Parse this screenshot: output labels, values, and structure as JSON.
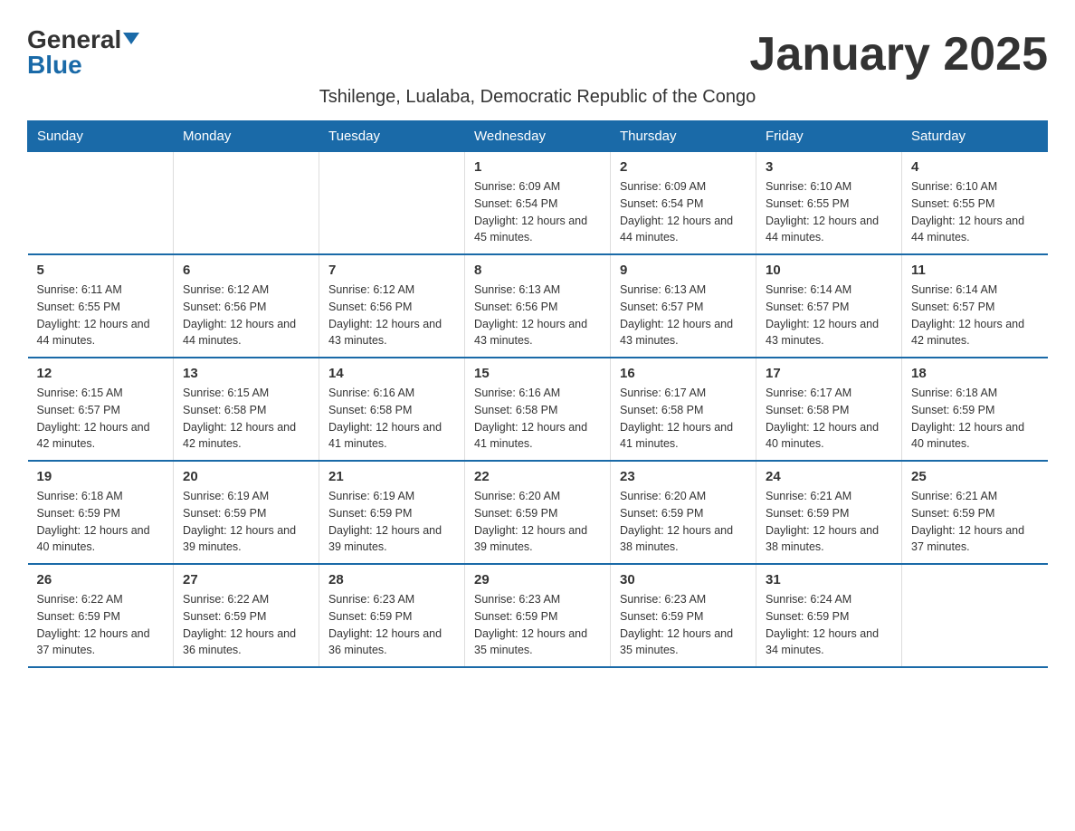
{
  "logo": {
    "general": "General",
    "blue": "Blue"
  },
  "title": "January 2025",
  "subtitle": "Tshilenge, Lualaba, Democratic Republic of the Congo",
  "days_of_week": [
    "Sunday",
    "Monday",
    "Tuesday",
    "Wednesday",
    "Thursday",
    "Friday",
    "Saturday"
  ],
  "weeks": [
    [
      {
        "day": "",
        "info": ""
      },
      {
        "day": "",
        "info": ""
      },
      {
        "day": "",
        "info": ""
      },
      {
        "day": "1",
        "info": "Sunrise: 6:09 AM\nSunset: 6:54 PM\nDaylight: 12 hours and 45 minutes."
      },
      {
        "day": "2",
        "info": "Sunrise: 6:09 AM\nSunset: 6:54 PM\nDaylight: 12 hours and 44 minutes."
      },
      {
        "day": "3",
        "info": "Sunrise: 6:10 AM\nSunset: 6:55 PM\nDaylight: 12 hours and 44 minutes."
      },
      {
        "day": "4",
        "info": "Sunrise: 6:10 AM\nSunset: 6:55 PM\nDaylight: 12 hours and 44 minutes."
      }
    ],
    [
      {
        "day": "5",
        "info": "Sunrise: 6:11 AM\nSunset: 6:55 PM\nDaylight: 12 hours and 44 minutes."
      },
      {
        "day": "6",
        "info": "Sunrise: 6:12 AM\nSunset: 6:56 PM\nDaylight: 12 hours and 44 minutes."
      },
      {
        "day": "7",
        "info": "Sunrise: 6:12 AM\nSunset: 6:56 PM\nDaylight: 12 hours and 43 minutes."
      },
      {
        "day": "8",
        "info": "Sunrise: 6:13 AM\nSunset: 6:56 PM\nDaylight: 12 hours and 43 minutes."
      },
      {
        "day": "9",
        "info": "Sunrise: 6:13 AM\nSunset: 6:57 PM\nDaylight: 12 hours and 43 minutes."
      },
      {
        "day": "10",
        "info": "Sunrise: 6:14 AM\nSunset: 6:57 PM\nDaylight: 12 hours and 43 minutes."
      },
      {
        "day": "11",
        "info": "Sunrise: 6:14 AM\nSunset: 6:57 PM\nDaylight: 12 hours and 42 minutes."
      }
    ],
    [
      {
        "day": "12",
        "info": "Sunrise: 6:15 AM\nSunset: 6:57 PM\nDaylight: 12 hours and 42 minutes."
      },
      {
        "day": "13",
        "info": "Sunrise: 6:15 AM\nSunset: 6:58 PM\nDaylight: 12 hours and 42 minutes."
      },
      {
        "day": "14",
        "info": "Sunrise: 6:16 AM\nSunset: 6:58 PM\nDaylight: 12 hours and 41 minutes."
      },
      {
        "day": "15",
        "info": "Sunrise: 6:16 AM\nSunset: 6:58 PM\nDaylight: 12 hours and 41 minutes."
      },
      {
        "day": "16",
        "info": "Sunrise: 6:17 AM\nSunset: 6:58 PM\nDaylight: 12 hours and 41 minutes."
      },
      {
        "day": "17",
        "info": "Sunrise: 6:17 AM\nSunset: 6:58 PM\nDaylight: 12 hours and 40 minutes."
      },
      {
        "day": "18",
        "info": "Sunrise: 6:18 AM\nSunset: 6:59 PM\nDaylight: 12 hours and 40 minutes."
      }
    ],
    [
      {
        "day": "19",
        "info": "Sunrise: 6:18 AM\nSunset: 6:59 PM\nDaylight: 12 hours and 40 minutes."
      },
      {
        "day": "20",
        "info": "Sunrise: 6:19 AM\nSunset: 6:59 PM\nDaylight: 12 hours and 39 minutes."
      },
      {
        "day": "21",
        "info": "Sunrise: 6:19 AM\nSunset: 6:59 PM\nDaylight: 12 hours and 39 minutes."
      },
      {
        "day": "22",
        "info": "Sunrise: 6:20 AM\nSunset: 6:59 PM\nDaylight: 12 hours and 39 minutes."
      },
      {
        "day": "23",
        "info": "Sunrise: 6:20 AM\nSunset: 6:59 PM\nDaylight: 12 hours and 38 minutes."
      },
      {
        "day": "24",
        "info": "Sunrise: 6:21 AM\nSunset: 6:59 PM\nDaylight: 12 hours and 38 minutes."
      },
      {
        "day": "25",
        "info": "Sunrise: 6:21 AM\nSunset: 6:59 PM\nDaylight: 12 hours and 37 minutes."
      }
    ],
    [
      {
        "day": "26",
        "info": "Sunrise: 6:22 AM\nSunset: 6:59 PM\nDaylight: 12 hours and 37 minutes."
      },
      {
        "day": "27",
        "info": "Sunrise: 6:22 AM\nSunset: 6:59 PM\nDaylight: 12 hours and 36 minutes."
      },
      {
        "day": "28",
        "info": "Sunrise: 6:23 AM\nSunset: 6:59 PM\nDaylight: 12 hours and 36 minutes."
      },
      {
        "day": "29",
        "info": "Sunrise: 6:23 AM\nSunset: 6:59 PM\nDaylight: 12 hours and 35 minutes."
      },
      {
        "day": "30",
        "info": "Sunrise: 6:23 AM\nSunset: 6:59 PM\nDaylight: 12 hours and 35 minutes."
      },
      {
        "day": "31",
        "info": "Sunrise: 6:24 AM\nSunset: 6:59 PM\nDaylight: 12 hours and 34 minutes."
      },
      {
        "day": "",
        "info": ""
      }
    ]
  ]
}
